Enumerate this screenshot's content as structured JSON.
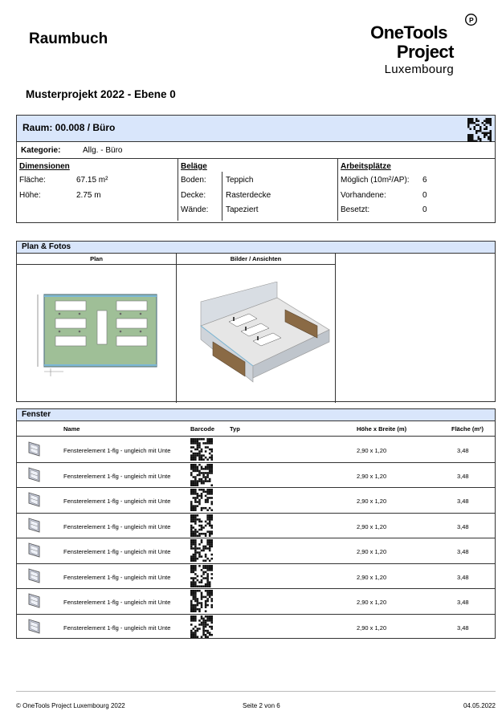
{
  "header": {
    "title": "Raumbuch",
    "logo_line1": "OneTools",
    "logo_line2": "Project",
    "logo_line3": "Luxembourg",
    "subtitle": "Musterprojekt 2022 - Ebene 0"
  },
  "room": {
    "title": "Raum: 00.008 / Büro",
    "kategorie_label": "Kategorie:",
    "kategorie_value": "Allg. - Büro",
    "dimensionen": {
      "heading": "Dimensionen",
      "flaeche_label": "Fläche:",
      "flaeche_value": "67.15 m²",
      "hoehe_label": "Höhe:",
      "hoehe_value": "2.75 m"
    },
    "belaege": {
      "heading": "Beläge",
      "boden_label": "Boden:",
      "boden_value": "Teppich",
      "decke_label": "Decke:",
      "decke_value": "Rasterdecke",
      "waende_label": "Wände:",
      "waende_value": "Tapeziert"
    },
    "arbeitsplaetze": {
      "heading": "Arbeitsplätze",
      "moeglich_label": "Möglich (10m²/AP):",
      "moeglich_value": "6",
      "vorhandene_label": "Vorhandene:",
      "vorhandene_value": "0",
      "besetzt_label": "Besetzt:",
      "besetzt_value": "0"
    }
  },
  "plan": {
    "heading": "Plan & Fotos",
    "col_plan": "Plan",
    "col_bilder": "Bilder / Ansichten"
  },
  "fenster": {
    "heading": "Fenster",
    "columns": {
      "name": "Name",
      "barcode": "Barcode",
      "typ": "Typ",
      "hoehe_breite": "Höhe x Breite (m)",
      "flaeche": "Fläche (m²)"
    },
    "rows": [
      {
        "name": "Fensterelement 1-flg - ungleich mit Unte",
        "typ": "",
        "hb": "2,90 x 1,20",
        "flaeche": "3,48"
      },
      {
        "name": "Fensterelement 1-flg - ungleich mit Unte",
        "typ": "",
        "hb": "2,90 x 1,20",
        "flaeche": "3,48"
      },
      {
        "name": "Fensterelement 1-flg - ungleich mit Unte",
        "typ": "",
        "hb": "2,90 x 1,20",
        "flaeche": "3,48"
      },
      {
        "name": "Fensterelement 1-flg - ungleich mit Unte",
        "typ": "",
        "hb": "2,90 x 1,20",
        "flaeche": "3,48"
      },
      {
        "name": "Fensterelement 1-flg - ungleich mit Unte",
        "typ": "",
        "hb": "2,90 x 1,20",
        "flaeche": "3,48"
      },
      {
        "name": "Fensterelement 1-flg - ungleich mit Unte",
        "typ": "",
        "hb": "2,90 x 1,20",
        "flaeche": "3,48"
      },
      {
        "name": "Fensterelement 1-flg - ungleich mit Unte",
        "typ": "",
        "hb": "2,90 x 1,20",
        "flaeche": "3,48"
      },
      {
        "name": "Fensterelement 1-flg - ungleich mit Unte",
        "typ": "",
        "hb": "2,90 x 1,20",
        "flaeche": "3,48"
      }
    ]
  },
  "footer": {
    "left": "© OneTools Project Luxembourg 2022",
    "center": "Seite 2 von 6",
    "right": "04.05.2022"
  }
}
